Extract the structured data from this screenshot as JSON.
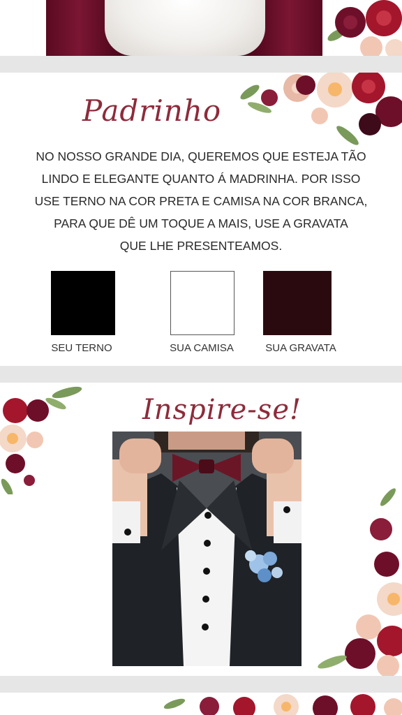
{
  "padrinho": {
    "title": "Padrinho",
    "message_lines": [
      "NO NOSSO GRANDE DIA, QUEREMOS QUE ESTEJA TÃO",
      "LINDO E ELEGANTE QUANTO Á MADRINHA. POR ISSO",
      "USE TERNO NA COR PRETA E CAMISA NA COR BRANCA,",
      "PARA QUE DÊ UM TOQUE A MAIS, USE A GRAVATA",
      "QUE LHE PRESENTEAMOS."
    ],
    "swatches": [
      {
        "label": "SEU TERNO",
        "color": "#000000"
      },
      {
        "label": "SUA CAMISA",
        "color": "#ffffff"
      },
      {
        "label": "SUA GRAVATA",
        "color": "#2b0a0f"
      }
    ]
  },
  "inspire": {
    "title": "Inspire-se!"
  },
  "theme": {
    "accent": "#8e2b3b",
    "flower_dark": "#6e0f2a",
    "flower_red": "#a4162c",
    "flower_blush": "#f1c7b4",
    "leaf": "#7a9a5a"
  }
}
